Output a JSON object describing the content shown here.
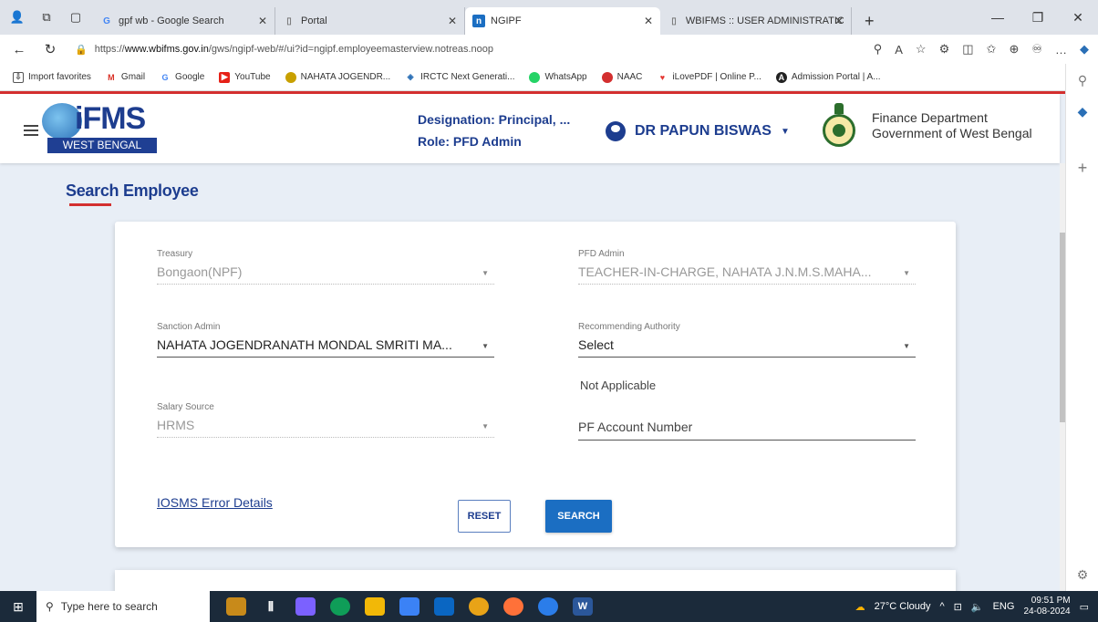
{
  "browser": {
    "tabs": [
      {
        "label": "gpf wb - Google Search",
        "icon": "google-icon"
      },
      {
        "label": "Portal",
        "icon": "page-icon"
      },
      {
        "label": "NGIPF",
        "icon": "ngipf-icon",
        "active": true
      },
      {
        "label": "WBIFMS :: USER ADMINISTRATIC",
        "icon": "page-icon"
      }
    ],
    "url_prefix": "https://",
    "url_domain": "www.wbifms.gov.in",
    "url_path": "/gws/ngipf-web/#/ui?id=ngipf.employeemasterview.notreas.noop",
    "favorites": [
      {
        "label": "Import favorites",
        "icon": "import-icon",
        "color": "#555"
      },
      {
        "label": "Gmail",
        "icon": "gmail-icon",
        "glyph": "M",
        "color": "#d93025"
      },
      {
        "label": "Google",
        "icon": "google-icon",
        "glyph": "G",
        "color": "#4285f4"
      },
      {
        "label": "YouTube",
        "icon": "youtube-icon",
        "glyph": "▶",
        "color": "#e62117"
      },
      {
        "label": "NAHATA JOGENDR...",
        "icon": "site-icon",
        "glyph": "●",
        "color": "#c8a000"
      },
      {
        "label": "IRCTC Next Generati...",
        "icon": "irctc-icon",
        "glyph": "◈",
        "color": "#2a6fb6"
      },
      {
        "label": "WhatsApp",
        "icon": "whatsapp-icon",
        "glyph": "●",
        "color": "#25d366"
      },
      {
        "label": "NAAC",
        "icon": "naac-icon",
        "glyph": "●",
        "color": "#d32f2f"
      },
      {
        "label": "iLovePDF | Online P...",
        "icon": "ilovepdf-icon",
        "glyph": "♥",
        "color": "#e53935"
      },
      {
        "label": "Admission Portal | A...",
        "icon": "admission-icon",
        "glyph": "A",
        "color": "#222"
      }
    ]
  },
  "header": {
    "logo_text": "iFMS",
    "logo_sub": "WEST BENGAL",
    "designation": "Designation: Principal, ...",
    "role": "Role: PFD Admin",
    "user_name": "DR PAPUN BISWAS",
    "dept_line1": "Finance Department",
    "dept_line2": "Government of West Bengal"
  },
  "page": {
    "title": "Search Employee"
  },
  "form": {
    "treasury": {
      "label": "Treasury",
      "value": "Bongaon(NPF)"
    },
    "pfd_admin": {
      "label": "PFD Admin",
      "value": "TEACHER-IN-CHARGE, NAHATA J.N.M.S.MAHA..."
    },
    "sanction_admin": {
      "label": "Sanction Admin",
      "value": "NAHATA JOGENDRANATH MONDAL SMRITI MA..."
    },
    "recommending_authority": {
      "label": "Recommending Authority",
      "value": "Select"
    },
    "not_applicable": "Not Applicable",
    "salary_source": {
      "label": "Salary Source",
      "value": "HRMS"
    },
    "pf_account_placeholder": "PF Account Number",
    "error_link": "IOSMS Error Details",
    "reset_label": "RESET",
    "search_label": "SEARCH"
  },
  "taskbar": {
    "search_placeholder": "Type here to search",
    "weather": "27°C  Cloudy",
    "lang": "ENG",
    "time": "09:51 PM",
    "date": "24-08-2024"
  },
  "colors": {
    "brand": "#1d3d8f",
    "accent_red": "#d32f2f",
    "search_button": "#1b6ec2"
  }
}
